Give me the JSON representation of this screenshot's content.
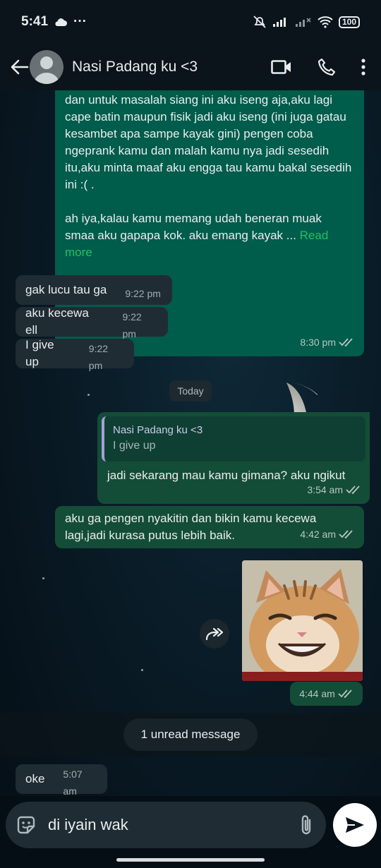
{
  "status": {
    "time": "5:41",
    "battery": "100"
  },
  "header": {
    "contact_name": "Nasi Padang ku <3"
  },
  "messages": {
    "long": {
      "text": "dan untuk masalah siang ini aku iseng aja,aku lagi cape batin maupun fisik jadi aku iseng (ini juga gatau kesambet apa sampe kayak gini) pengen coba ngeprank kamu dan malah kamu nya jadi sesedih itu,aku minta maaf aku engga tau kamu bakal sesedih ini :( .\n\nah iya,kalau kamu memang udah beneran muak smaa aku gapapa kok. aku emang kayak ... ",
      "read_more": "Read more",
      "time": "8:30 pm"
    },
    "in1": {
      "text": "gak lucu tau ga",
      "time": "9:22 pm"
    },
    "in2": {
      "text": "aku kecewa ell",
      "time": "9:22 pm"
    },
    "in3": {
      "text": "I give up",
      "time": "9:22 pm"
    },
    "date_chip": "Today",
    "reply": {
      "quote_name": "Nasi Padang ku <3",
      "quote_text": "I give up",
      "text": "jadi sekarang mau kamu gimana? aku ngikut",
      "time": "3:54 am"
    },
    "breakup": {
      "text": "aku ga pengen nyakitin dan bikin kamu kecewa lagi,jadi kurasa putus lebih baik.",
      "time": "4:42 am"
    },
    "image": {
      "time": "4:44 am"
    },
    "unread": "1 unread message",
    "oke": {
      "text": "oke",
      "time": "5:07 am"
    }
  },
  "composer": {
    "text": "di iyain wak"
  },
  "colors": {
    "outgoing": "#005c4b",
    "incoming": "#202c33",
    "accent": "#21c063"
  }
}
